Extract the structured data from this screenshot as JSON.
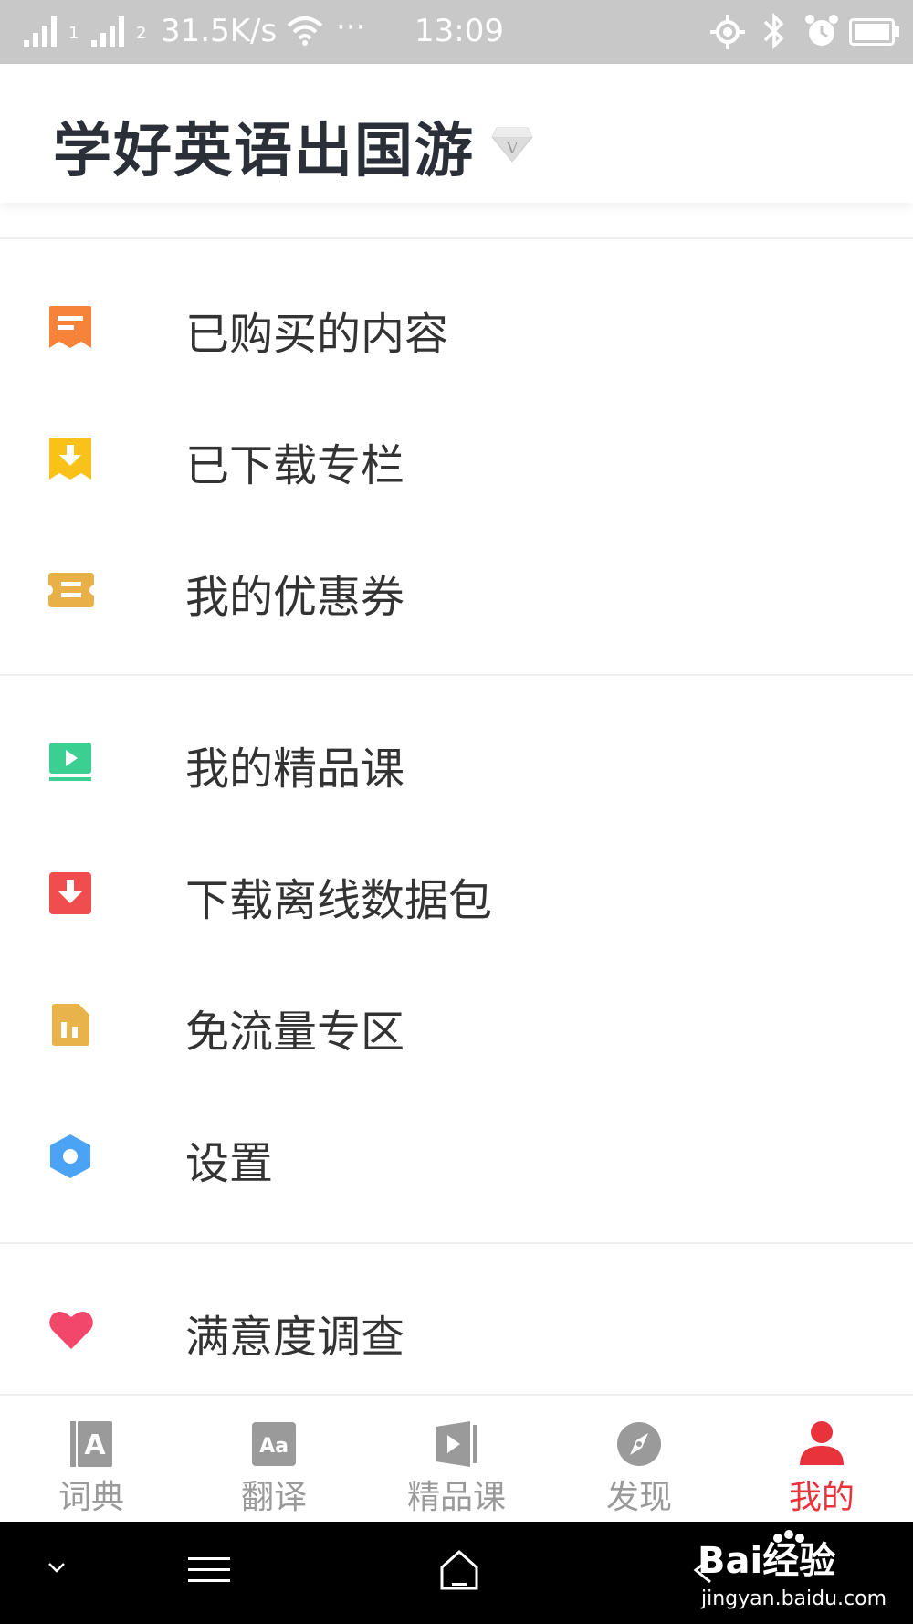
{
  "status_bar": {
    "sim1": "1",
    "sim2": "2",
    "network_speed": "31.5K/s",
    "more": "···",
    "time": "13:09"
  },
  "header": {
    "title": "学好英语出国游",
    "vip_badge": "V"
  },
  "menu": {
    "group1": [
      {
        "label": "已购买的内容",
        "icon": "receipt-icon",
        "color": "#f7823a"
      },
      {
        "label": "已下载专栏",
        "icon": "download-icon",
        "color": "#f9c21a"
      },
      {
        "label": "我的优惠券",
        "icon": "coupon-icon",
        "color": "#e8b047"
      }
    ],
    "group2": [
      {
        "label": "我的精品课",
        "icon": "play-video-icon",
        "color": "#3bcf91"
      },
      {
        "label": "下载离线数据包",
        "icon": "offline-download-icon",
        "color": "#f04e4e"
      },
      {
        "label": "免流量专区",
        "icon": "sim-card-icon",
        "color": "#e8b34a"
      },
      {
        "label": "设置",
        "icon": "settings-hexagon-icon",
        "color": "#4aa3f5"
      }
    ],
    "group3": [
      {
        "label": "满意度调查",
        "icon": "heart-icon",
        "color": "#f2466a"
      }
    ]
  },
  "bottom_nav": {
    "tabs": [
      {
        "label": "词典",
        "icon": "dictionary-icon",
        "active": false
      },
      {
        "label": "翻译",
        "icon": "translate-icon",
        "active": false
      },
      {
        "label": "精品课",
        "icon": "course-icon",
        "active": false
      },
      {
        "label": "发现",
        "icon": "compass-icon",
        "active": false
      },
      {
        "label": "我的",
        "icon": "user-icon",
        "active": true
      }
    ],
    "active_color": "#e8323c",
    "inactive_color": "#9a9a9a"
  },
  "watermark": {
    "logo": "Bai经验",
    "url": "jingyan.baidu.com"
  }
}
